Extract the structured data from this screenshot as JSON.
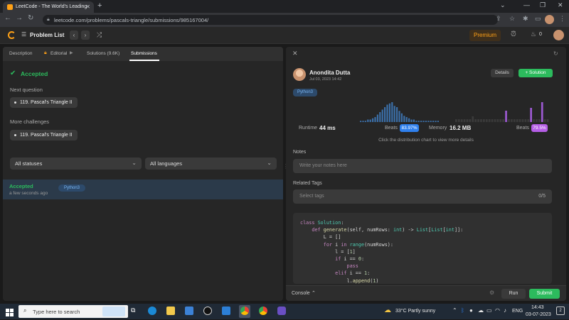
{
  "browser": {
    "tab_title": "LeetCode - The World's Leading",
    "url": "leetcode.com/problems/pascals-triangle/submissions/985167004/"
  },
  "nav": {
    "problem_list": "Problem List",
    "premium": "Premium",
    "streak_count": "0"
  },
  "left": {
    "tabs": [
      {
        "label": "Description"
      },
      {
        "label": "Editorial"
      },
      {
        "label": "Solutions (9.6K)"
      },
      {
        "label": "Submissions"
      }
    ],
    "status": "Accepted",
    "next_question_label": "Next question",
    "next_question": "119. Pascal's Triangle II",
    "more_challenges_label": "More challenges",
    "more_challenge": "119. Pascal's Triangle II",
    "filter_status": "All statuses",
    "filter_language": "All languages",
    "submission": {
      "status": "Accepted",
      "time": "a few seconds ago",
      "language": "Python3"
    }
  },
  "right": {
    "user_name": "Anondita Dutta",
    "date": "Jul 03, 2023 14:42",
    "details_label": "Details",
    "solution_label": "Solution",
    "language_tag": "Python3",
    "runtime_label": "Runtime",
    "runtime_value": "44 ms",
    "runtime_beats_label": "Beats",
    "runtime_beats": "83.97%",
    "memory_label": "Memory",
    "memory_value": "16.2 MB",
    "memory_beats_label": "Beats",
    "memory_beats": "79.5%",
    "distribution_hint": "Click the distribution chart to view more details",
    "notes_label": "Notes",
    "notes_placeholder": "Write your notes here",
    "tags_label": "Related Tags",
    "tags_placeholder": "Select tags",
    "tags_count": "0/5",
    "code_lines": [
      "class Solution:",
      "    def generate(self, numRows: int) -> List[List[int]]:",
      "        L = []",
      "        for i in range(numRows):",
      "            l = [1]",
      "            if i == 0:",
      "                pass",
      "            elif i == 1:",
      "                l.append(1)"
    ],
    "console_label": "Console",
    "run_label": "Run",
    "submit_label": "Submit"
  },
  "chart_data": [
    {
      "type": "bar",
      "values": [
        1,
        1,
        1,
        2,
        2,
        3,
        4,
        6,
        8,
        10,
        12,
        14,
        15,
        16,
        13,
        12,
        9,
        7,
        5,
        4,
        3,
        2,
        2,
        1,
        1,
        1,
        1,
        1,
        1,
        1,
        1,
        1,
        1
      ]
    },
    {
      "type": "bar",
      "values": [
        1,
        1,
        1,
        1,
        1,
        1,
        2,
        1,
        1,
        1,
        1,
        1,
        1,
        1,
        1,
        1,
        1,
        1,
        4,
        1,
        1,
        1,
        1,
        1,
        1,
        1,
        1,
        5,
        1,
        1,
        1,
        7,
        1,
        1
      ]
    }
  ],
  "taskbar": {
    "search_placeholder": "Type here to search",
    "weather": "33°C  Partly sunny",
    "lang": "ENG",
    "time": "14:43",
    "date": "03-07-2023",
    "notif_count": "2"
  },
  "colors": {
    "accent_green": "#2cbb5d",
    "accent_orange": "#ffa116",
    "beats_blue": "#2f80ed",
    "beats_purple": "#b55ee6",
    "bar_blue": "#3b6fa8",
    "bar_purple": "#9b59d0"
  }
}
